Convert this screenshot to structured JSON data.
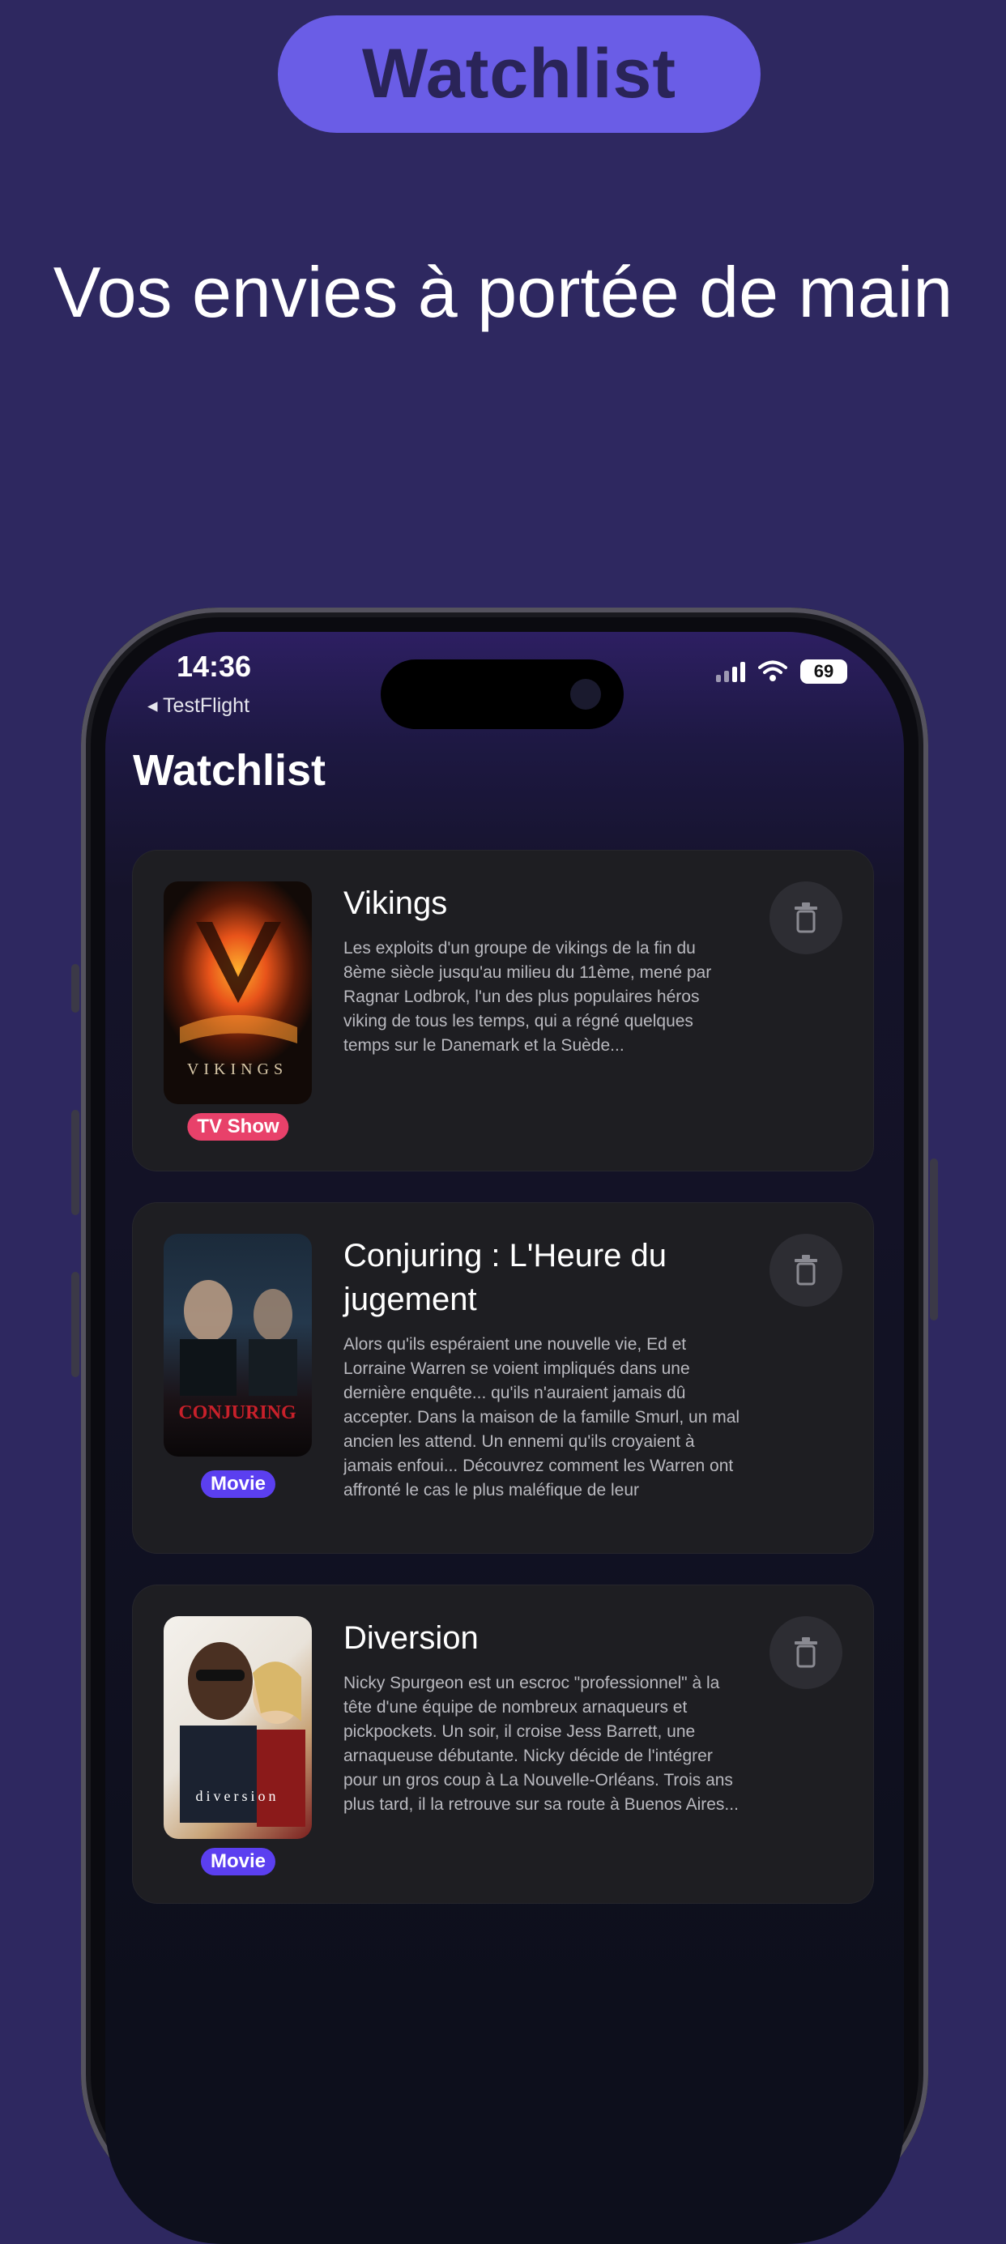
{
  "promo": {
    "pill_label": "Watchlist",
    "headline": "Vos envies à portée de main"
  },
  "status_bar": {
    "time": "14:36",
    "back_app": "◂ TestFlight",
    "battery": "69"
  },
  "app": {
    "title": "Watchlist"
  },
  "items": [
    {
      "title": "Vikings",
      "description": "Les exploits d'un groupe de vikings de la fin du 8ème siècle jusqu'au milieu du 11ème, mené par Ragnar Lodbrok, l'un des plus populaires héros viking de tous les temps, qui a régné quelques temps sur le Danemark et la Suède...",
      "badge": "TV Show",
      "badge_color": "#e8416a",
      "poster_caption": "VIKINGS"
    },
    {
      "title": "Conjuring : L'Heure du jugement",
      "description": "Alors qu'ils espéraient une nouvelle vie, Ed et Lorraine Warren se voient impliqués dans une dernière enquête... qu'ils n'auraient jamais dû accepter. Dans la maison de la famille Smurl, un mal ancien les attend. Un ennemi qu'ils croyaient à jamais enfoui... Découvrez comment les Warren ont affronté le cas le plus maléfique de leur",
      "badge": "Movie",
      "badge_color": "#5b3ff0",
      "poster_caption": "CONJURING"
    },
    {
      "title": "Diversion",
      "description": "Nicky Spurgeon est un escroc \"professionnel\" à la tête d'une équipe de nombreux arnaqueurs et pickpockets. Un soir, il croise Jess Barrett, une arnaqueuse débutante. Nicky décide de l'intégrer pour un gros coup à La Nouvelle-Orléans. Trois ans plus tard, il la retrouve sur sa route à Buenos Aires...",
      "badge": "Movie",
      "badge_color": "#5b3ff0",
      "poster_caption": "diversion"
    }
  ]
}
